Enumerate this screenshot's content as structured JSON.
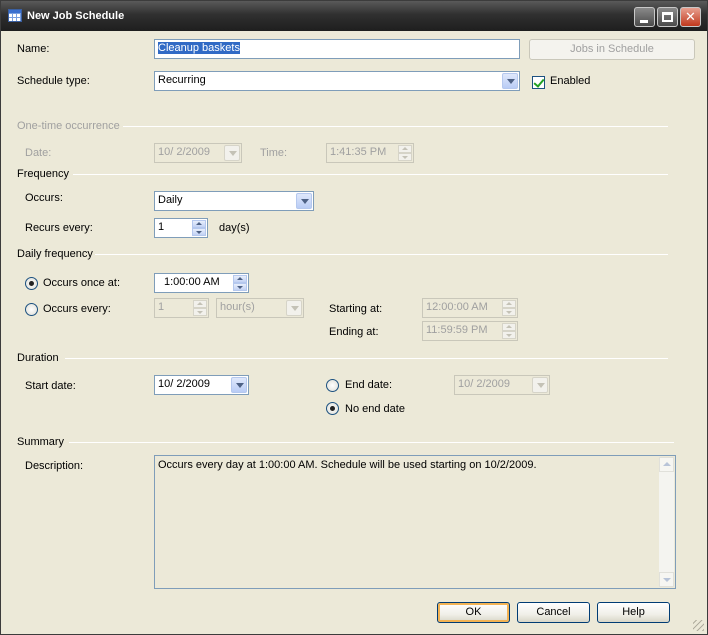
{
  "window": {
    "title": "New Job Schedule",
    "controls": {
      "minimize": "minimize-icon",
      "maximize": "maximize-icon",
      "close": "close-icon"
    }
  },
  "name": {
    "label": "Name:",
    "value": "Cleanup baskets"
  },
  "jobs_in_schedule_label": "Jobs in Schedule",
  "schedule_type": {
    "label": "Schedule type:",
    "value": "Recurring"
  },
  "enabled": {
    "label": "Enabled",
    "checked": true
  },
  "one_time": {
    "group_label": "One-time occurrence",
    "date_label": "Date:",
    "date_value": "10/  2/2009",
    "time_label": "Time:",
    "time_value": "1:41:35 PM"
  },
  "frequency": {
    "group_label": "Frequency",
    "occurs_label": "Occurs:",
    "occurs_value": "Daily",
    "recurs_label": "Recurs every:",
    "recurs_value": "1",
    "recurs_unit": "day(s)"
  },
  "daily_frequency": {
    "group_label": "Daily frequency",
    "once_label": "Occurs once at:",
    "once_value": "1:00:00 AM",
    "every_label": "Occurs every:",
    "every_value": "1",
    "every_unit": "hour(s)",
    "starting_label": "Starting at:",
    "starting_value": "12:00:00 AM",
    "ending_label": "Ending at:",
    "ending_value": "11:59:59 PM",
    "selected": "once"
  },
  "duration": {
    "group_label": "Duration",
    "start_label": "Start date:",
    "start_value": "10/  2/2009",
    "end_label": "End date:",
    "end_value": "10/  2/2009",
    "no_end_label": "No end date",
    "selected": "no_end"
  },
  "summary": {
    "group_label": "Summary",
    "description_label": "Description:",
    "description_text": "Occurs every day at 1:00:00 AM. Schedule will be used starting on 10/2/2009."
  },
  "buttons": {
    "ok": "OK",
    "cancel": "Cancel",
    "help": "Help"
  },
  "colors": {
    "accent": "#316ac5",
    "titlebar": "#303030",
    "radio_selected": "#21a121"
  }
}
